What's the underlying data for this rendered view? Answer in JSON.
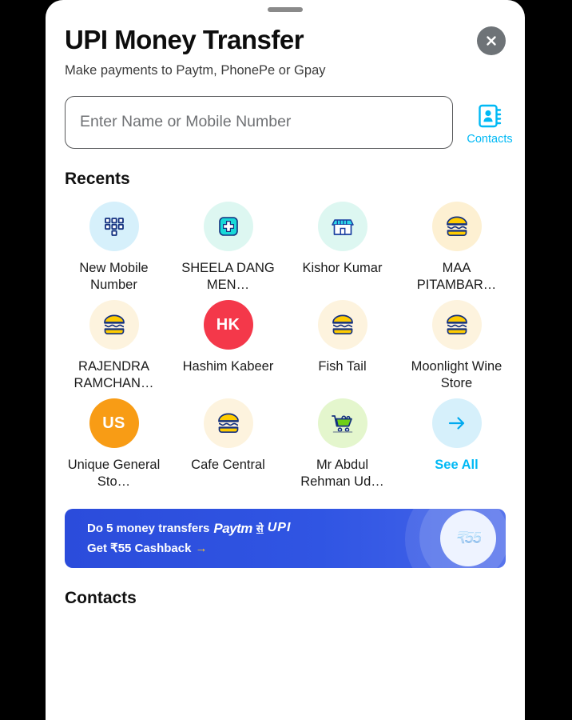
{
  "sheet": {
    "drag_handle": "drag-handle",
    "title": "UPI Money Transfer",
    "subtitle": "Make payments to Paytm, PhonePe or Gpay",
    "close_label": "✕"
  },
  "search": {
    "placeholder": "Enter Name or Mobile Number",
    "value": "",
    "contacts_label": "Contacts",
    "contacts_icon": "contact-book-icon"
  },
  "recents": {
    "heading": "Recents",
    "items": [
      {
        "label": "New Mobile Number",
        "icon": "dialpad-icon",
        "bg": "#d6f0fb",
        "type": "icon"
      },
      {
        "label": "SHEELA DANG MEN…",
        "icon": "pharmacy-cross-icon",
        "bg": "#ddf7f1",
        "type": "icon"
      },
      {
        "label": "Kishor Kumar",
        "icon": "storefront-icon",
        "bg": "#ddf7f1",
        "type": "icon"
      },
      {
        "label": "MAA PITAMBAR…",
        "icon": "burger-icon",
        "bg": "#fdf0d2",
        "type": "icon"
      },
      {
        "label": "RAJENDRA RAMCHAN…",
        "icon": "burger-icon",
        "bg": "#fdf3de",
        "type": "icon"
      },
      {
        "label": "Hashim Kabeer",
        "icon": "initials-avatar",
        "bg": "#f4384a",
        "type": "initials",
        "initials": "HK"
      },
      {
        "label": "Fish Tail",
        "icon": "burger-icon",
        "bg": "#fdf3de",
        "type": "icon"
      },
      {
        "label": "Moonlight Wine Store",
        "icon": "burger-icon",
        "bg": "#fdf3de",
        "type": "icon"
      },
      {
        "label": "Unique General Sto…",
        "icon": "initials-avatar",
        "bg": "#f89c15",
        "type": "initials",
        "initials": "US"
      },
      {
        "label": "Cafe Central",
        "icon": "burger-icon",
        "bg": "#fdf3de",
        "type": "icon"
      },
      {
        "label": "Mr Abdul Rehman Ud…",
        "icon": "shopping-cart-icon",
        "bg": "#e4f6cd",
        "type": "icon"
      },
      {
        "label": "See All",
        "icon": "arrow-right-icon",
        "bg": "#d6f0fb",
        "type": "link"
      }
    ]
  },
  "promo": {
    "line1_prefix": "Do 5 money transfers",
    "brand": "Paytm",
    "se": "से",
    "upi": "UPI",
    "line2": "Get ₹55 Cashback",
    "arrow": "→",
    "amount_art": "₹55"
  },
  "contacts_section": {
    "heading": "Contacts"
  },
  "colors": {
    "accent_blue": "#00b9f5",
    "banner_blue": "#3055e3",
    "burger_yellow": "#ffcc00",
    "burger_navy": "#13307f",
    "red_avatar": "#f4384a",
    "orange_avatar": "#f89c15"
  }
}
